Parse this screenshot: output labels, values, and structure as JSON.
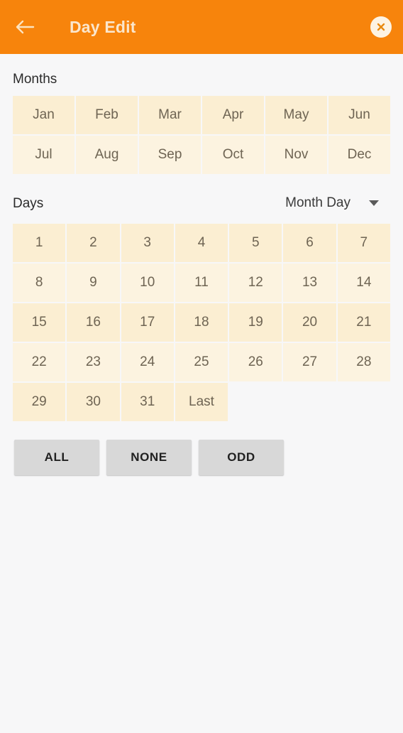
{
  "header": {
    "title": "Day Edit",
    "back_icon": "arrow-left-icon",
    "close_icon": "close-circle-icon",
    "background_color": "#f7840c",
    "title_color": "#fbe6cc"
  },
  "months_section": {
    "label": "Months",
    "columns": 6,
    "items": [
      "Jan",
      "Feb",
      "Mar",
      "Apr",
      "May",
      "Jun",
      "Jul",
      "Aug",
      "Sep",
      "Oct",
      "Nov",
      "Dec"
    ]
  },
  "days_section": {
    "label": "Days",
    "mode_dropdown": {
      "value": "Month Day",
      "caret_icon": "chevron-down-icon"
    },
    "columns": 7,
    "items": [
      "1",
      "2",
      "3",
      "4",
      "5",
      "6",
      "7",
      "8",
      "9",
      "10",
      "11",
      "12",
      "13",
      "14",
      "15",
      "16",
      "17",
      "18",
      "19",
      "20",
      "21",
      "22",
      "23",
      "24",
      "25",
      "26",
      "27",
      "28",
      "29",
      "30",
      "31",
      "Last"
    ]
  },
  "actions": {
    "all_label": "ALL",
    "none_label": "NONE",
    "odd_label": "ODD"
  },
  "colors": {
    "accent": "#f7840c",
    "cell": "#fbeed2",
    "cell_alt": "#fcf3e0",
    "page_background": "#f7f7f8",
    "button": "#d8d8d8"
  }
}
